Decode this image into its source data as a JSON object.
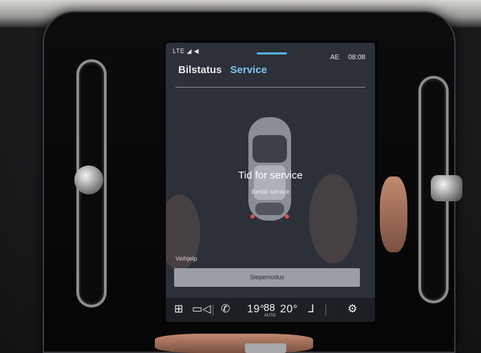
{
  "status_bar": {
    "signal_text": "LTE ◢ ◀",
    "language": "AE",
    "time": "08:08"
  },
  "header": {
    "tabs": [
      {
        "label": "Bilstatus",
        "active": false
      },
      {
        "label": "Service",
        "active": true
      }
    ]
  },
  "service": {
    "title": "Tid for service",
    "link": "Bestill service"
  },
  "roadside": {
    "section_label": "Veihjelp",
    "button_label": "Slepemodus"
  },
  "climate_bar": {
    "icons": [
      "apps-grid-icon",
      "camera-icon",
      "phone-icon",
      "fan-icon",
      "seat-heat-icon",
      "settings-gear-icon"
    ],
    "left_temp": "19°",
    "fan_glyph": "88",
    "fan_label": "AUTO",
    "right_temp": "20°"
  },
  "colors": {
    "accent": "#7dc8f0",
    "screen_bg": "#2c3038"
  }
}
